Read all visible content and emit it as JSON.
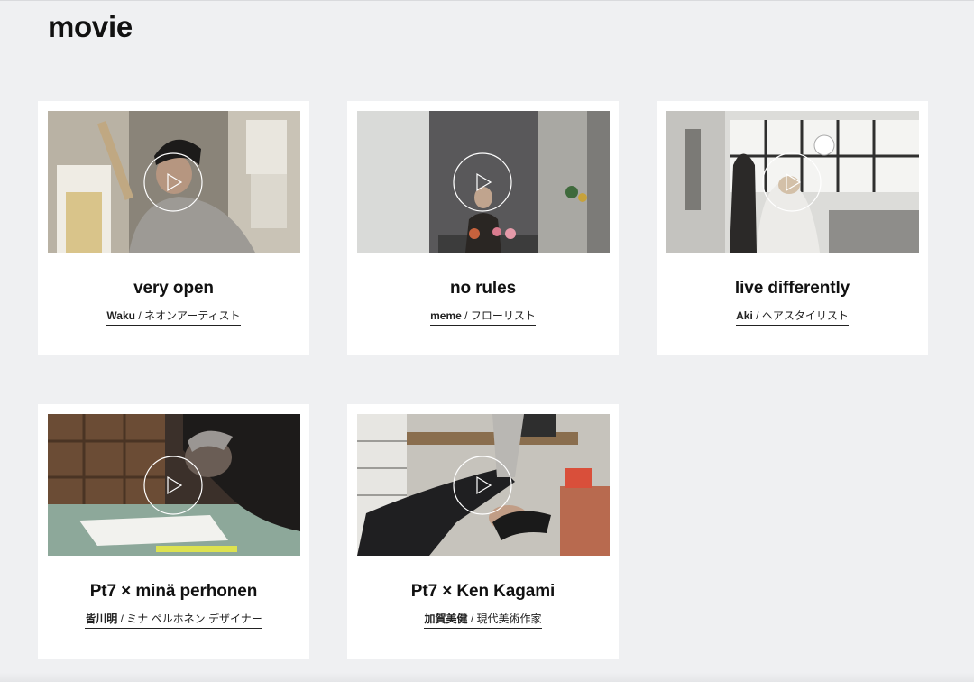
{
  "page": {
    "title": "movie"
  },
  "cards": [
    {
      "title": "very open",
      "name": "Waku",
      "sep": " / ",
      "role": "ネオンアーティスト"
    },
    {
      "title": "no rules",
      "name": "meme",
      "sep": " / ",
      "role": "フローリスト"
    },
    {
      "title": "live differently",
      "name": "Aki",
      "sep": " / ",
      "role": "ヘアスタイリスト"
    },
    {
      "title": "Pt7 × minä perhonen",
      "name": "皆川明",
      "sep": " / ",
      "role": "ミナ ペルホネン デザイナー"
    },
    {
      "title": "Pt7 × Ken Kagami",
      "name": "加賀美健",
      "sep": " / ",
      "role": "現代美術作家"
    }
  ],
  "icons": {
    "play": "play-icon"
  },
  "colors": {
    "background": "#eff0f2",
    "card": "#ffffff",
    "text": "#111111"
  }
}
